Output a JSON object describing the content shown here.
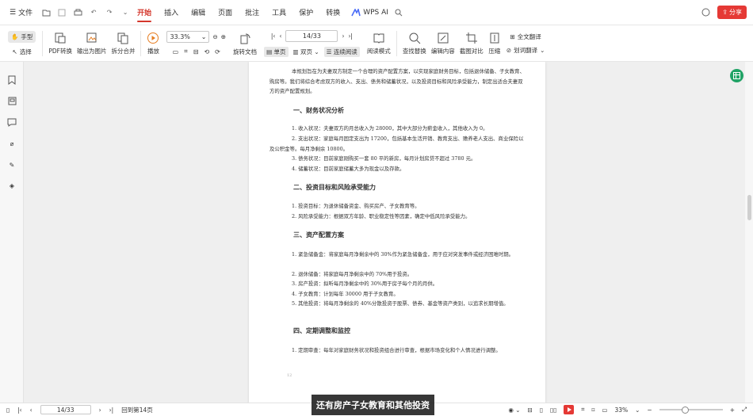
{
  "menubar": {
    "file_label": "文件",
    "tabs": [
      "开始",
      "插入",
      "编辑",
      "页面",
      "批注",
      "工具",
      "保护",
      "转换"
    ],
    "active_tab": "开始",
    "wps_ai_label": "WPS AI",
    "share_label": "分享"
  },
  "toolbar": {
    "hand_label": "手型",
    "select_label": "选择",
    "pdf_convert": "PDF转换",
    "export_image": "输出为图片",
    "split_merge": "拆分合并",
    "play": "播放",
    "zoom_value": "33.3%",
    "page_value": "14/33",
    "rotate": "旋转文档",
    "single": "单页",
    "double": "双页",
    "continuous": "连续阅读",
    "reading_mode": "阅读模式",
    "find_replace": "查找替换",
    "edit_content": "编辑内容",
    "compare": "截图对比",
    "compress": "压缩",
    "full_translate": "全文翻译",
    "word_translate": "划词翻译"
  },
  "document": {
    "intro": "本规划旨在为夫妻双方制定一个合理的资产配置方案，以实现家庭财务目标，包括退休储备、子女教育、购房等。我们将综合考虑双方的收入、支出、债务和储蓄状况，以及投资目标和风险承受能力，制定出适合夫妻双方的资产配置规划。",
    "s1_title": "一、财务状况分析",
    "s1_items": [
      "1. 收入状况：夫妻双方的月总收入为 28000，其中大部分为薪金收入，其他收入为 0。",
      "2. 支出状况：家庭每月固定支出为 17200，包括基本生活开销、教育支出、赡养老人支出、商业保险以及公积金等。每月净剩余 10800。",
      "3. 债务状况：目前家庭刚购买一套 80 平的新房，每月计划房贷不超过 3780 元。",
      "4. 储蓄状况：目前家庭储蓄大多为现金以及存款。"
    ],
    "s2_title": "二、投资目标和风险承受能力",
    "s2_items": [
      "1. 投资目标：为退休储备资金、购买房产、子女教育等。",
      "2. 风险承受能力：根据双方年龄、职业稳定性等因素，确定中低风险承受能力。"
    ],
    "s3_title": "三、资产配置方案",
    "s3_items": [
      "1. 紧急储备金：将家庭每月净剩余中的 30%作为紧急储备金，用于应对突发事件或经济困难时期。",
      "2. 退休储备：将家庭每月净剩余中的 70%用于投资。",
      "3. 房产投资：拟听每月净剩余中的 30%用于房子每个月的月供。",
      "4. 子女教育：计划每年 30000 用于子女教育。",
      "5. 其他投资：将每月净剩余的 40%分散投资于股票、债券、基金等资产类别，以追求长期增值。"
    ],
    "s4_title": "四、定期调整和监控",
    "s4_items": [
      "1. 定期审查：每年对家庭财务状况和投资组合进行审查，根据市场变化和个人情况进行调整。"
    ],
    "page_number": "12"
  },
  "statusbar": {
    "page_value": "14/33",
    "back_label": "回到第14页",
    "zoom_value": "33%"
  },
  "subtitle": "还有房产子女教育和其他投资",
  "colors": {
    "accent": "#d4372c",
    "share": "#e53935",
    "green": "#21a366"
  }
}
